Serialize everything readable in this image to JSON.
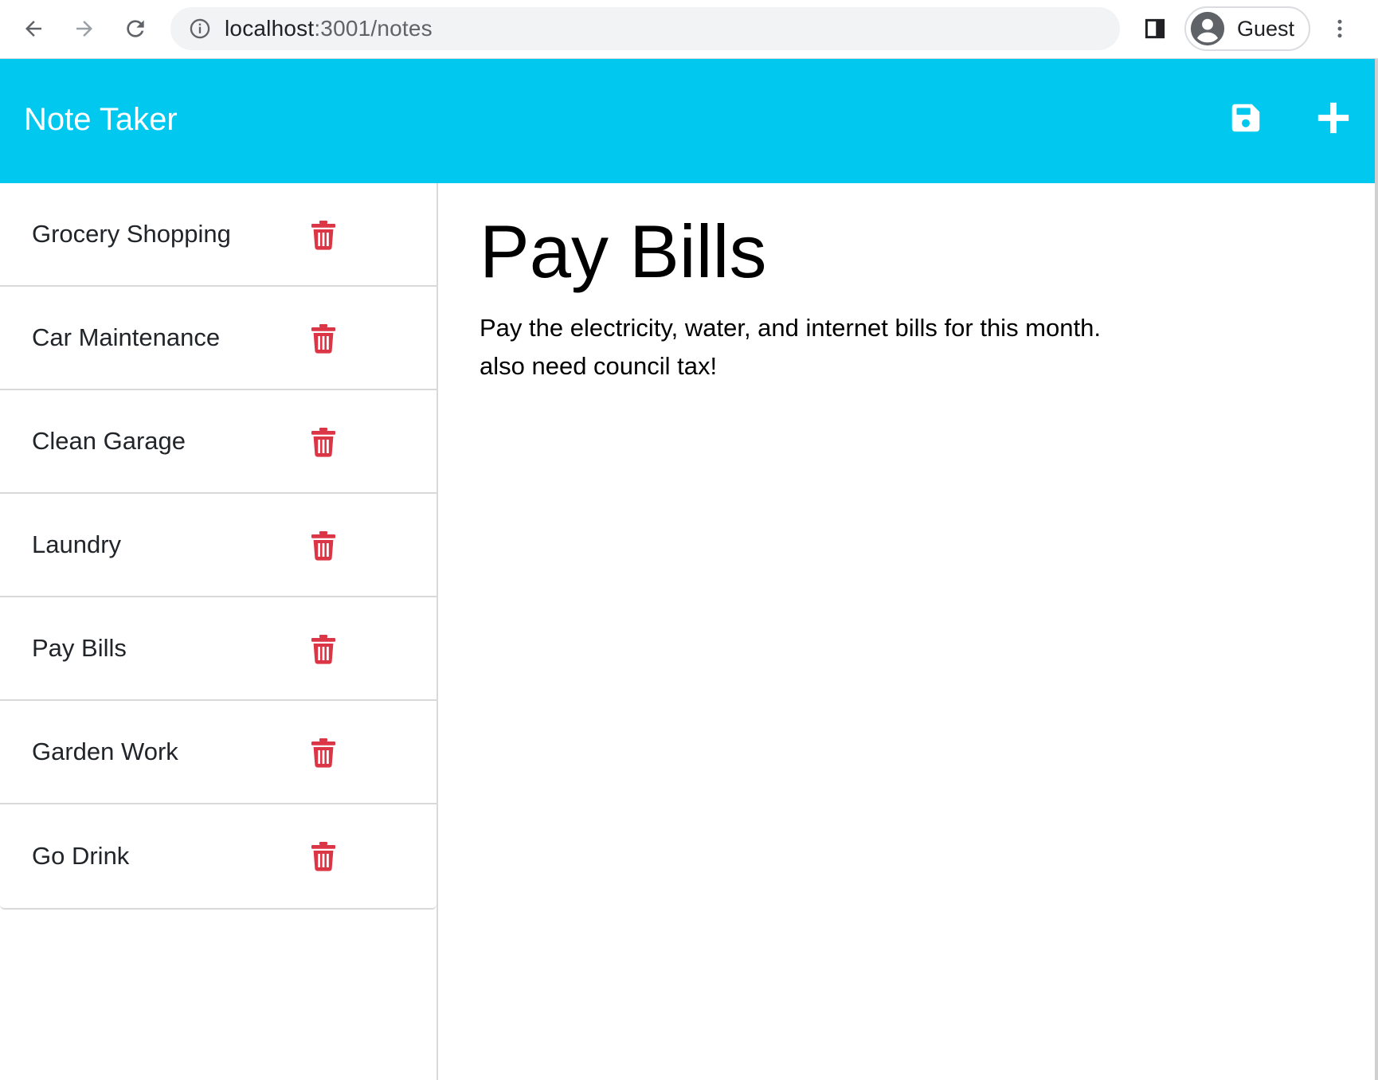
{
  "browser": {
    "url_host": "localhost",
    "url_path": ":3001/notes",
    "profile_name": "Guest"
  },
  "header": {
    "brand": "Note Taker",
    "save_icon": "save-icon",
    "new_icon": "plus-icon",
    "accent_color": "#00c8ef"
  },
  "sidebar": {
    "notes": [
      {
        "title": "Grocery Shopping"
      },
      {
        "title": "Car Maintenance"
      },
      {
        "title": "Clean Garage"
      },
      {
        "title": "Laundry"
      },
      {
        "title": "Pay Bills"
      },
      {
        "title": "Garden Work"
      },
      {
        "title": "Go Drink"
      }
    ],
    "delete_icon": "trash-icon",
    "delete_color": "#dc3545"
  },
  "main": {
    "note_title": "Pay Bills",
    "note_text": "Pay the electricity, water, and internet bills for this month.\nalso need council tax!"
  }
}
